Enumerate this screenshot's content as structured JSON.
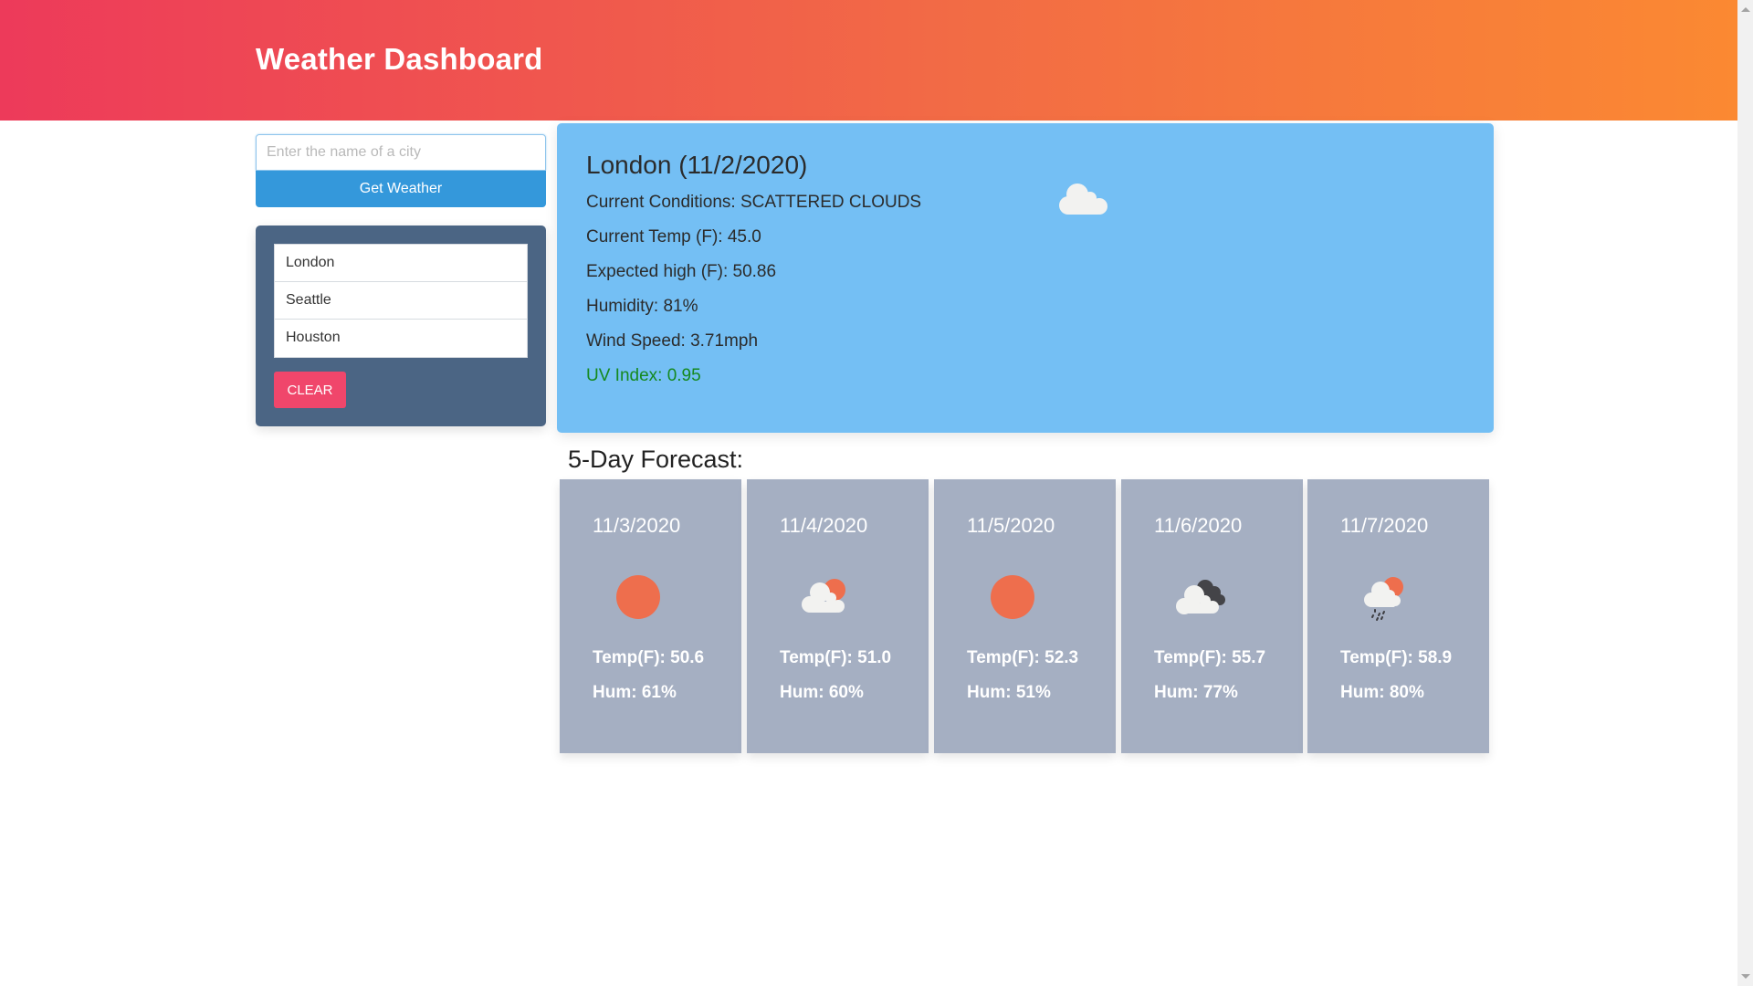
{
  "header": {
    "title": "Weather Dashboard"
  },
  "search": {
    "placeholder": "Enter the name of a city",
    "value": "",
    "button_label": "Get Weather"
  },
  "history": {
    "items": [
      {
        "label": "London"
      },
      {
        "label": "Seattle"
      },
      {
        "label": "Houston"
      }
    ],
    "clear_label": "CLEAR"
  },
  "current": {
    "title": "London (11/2/2020)",
    "conditions": "Current Conditions: SCATTERED CLOUDS",
    "temp": "Current Temp (F): 45.0",
    "high": "Expected high (F): 50.86",
    "humidity": "Humidity: 81%",
    "wind": "Wind Speed: 3.71mph",
    "uv": "UV Index: 0.95",
    "icon": "cloud-icon"
  },
  "forecast": {
    "heading": "5-Day Forecast:",
    "days": [
      {
        "date": "11/3/2020",
        "icon": "sun-icon",
        "temp": "Temp(F): 50.6",
        "hum": "Hum: 61%"
      },
      {
        "date": "11/4/2020",
        "icon": "partly-cloudy-icon",
        "temp": "Temp(F): 51.0",
        "hum": "Hum: 60%"
      },
      {
        "date": "11/5/2020",
        "icon": "sun-icon",
        "temp": "Temp(F): 52.3",
        "hum": "Hum: 51%"
      },
      {
        "date": "11/6/2020",
        "icon": "broken-clouds-icon",
        "temp": "Temp(F): 55.7",
        "hum": "Hum: 77%"
      },
      {
        "date": "11/7/2020",
        "icon": "rain-icon",
        "temp": "Temp(F): 58.9",
        "hum": "Hum: 80%"
      }
    ]
  },
  "colors": {
    "header_gradient_start": "#ED3A5A",
    "header_gradient_end": "#FB8932",
    "button_primary": "#3498DB",
    "history_panel": "#4B6584",
    "clear_button": "#F0466B",
    "current_card": "#74BFF4",
    "forecast_card": "#A5AFC2",
    "uv_index_text": "#15891F",
    "sun": "#EE6E4D",
    "cloud": "#F2F2F0",
    "dark_cloud": "#444448"
  }
}
